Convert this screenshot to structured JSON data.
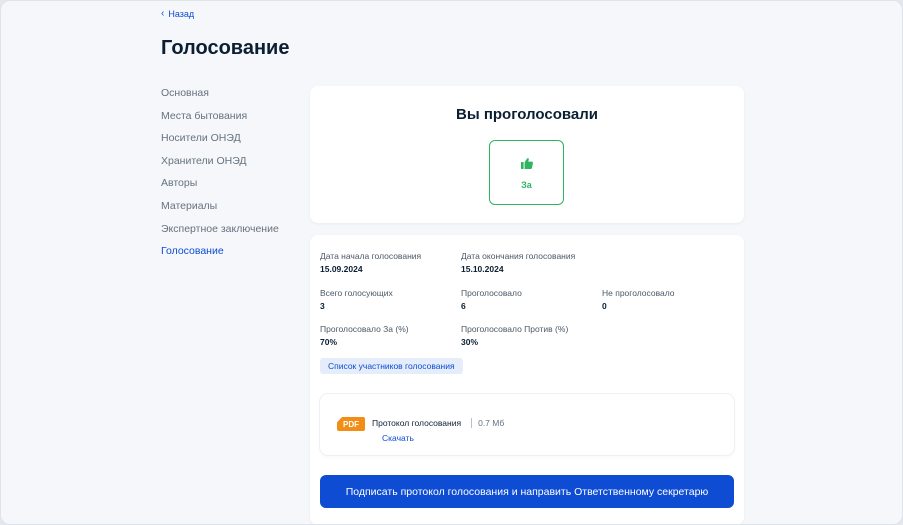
{
  "header": {
    "back_label": "Назад",
    "title": "Голосование"
  },
  "sidebar": {
    "items": [
      {
        "label": "Основная",
        "active": false
      },
      {
        "label": "Места бытования",
        "active": false
      },
      {
        "label": "Носители ОНЭД",
        "active": false
      },
      {
        "label": "Хранители ОНЭД",
        "active": false
      },
      {
        "label": "Авторы",
        "active": false
      },
      {
        "label": "Материалы",
        "active": false
      },
      {
        "label": "Экспертное заключение",
        "active": false
      },
      {
        "label": "Голосование",
        "active": true
      }
    ]
  },
  "vote": {
    "title": "Вы проголосовали",
    "choice_label": "За",
    "choice_icon": "thumbs-up-icon",
    "choice_color": "#2eb561"
  },
  "stats": {
    "start_label": "Дата начала голосования",
    "start_value": "15.09.2024",
    "end_label": "Дата окончания голосования",
    "end_value": "15.10.2024",
    "total_label": "Всего голосующих",
    "total_value": "3",
    "voted_label": "Проголосовало",
    "voted_value": "6",
    "not_voted_label": "Не проголосовало",
    "not_voted_value": "0",
    "for_label": "Проголосовало За (%)",
    "for_value": "70%",
    "against_label": "Проголосовало Против (%)",
    "against_value": "30%",
    "participants_link": "Список участников голосования"
  },
  "file": {
    "badge": "PDF",
    "name": "Протокол голосования",
    "size": "0.7 Мб",
    "download_label": "Скачать"
  },
  "actions": {
    "sign_label": "Подписать протокол голосования и направить Ответственному секретарю"
  },
  "colors": {
    "accent": "#0d4cd3",
    "success": "#2eb561",
    "pdf": "#f28d16"
  }
}
